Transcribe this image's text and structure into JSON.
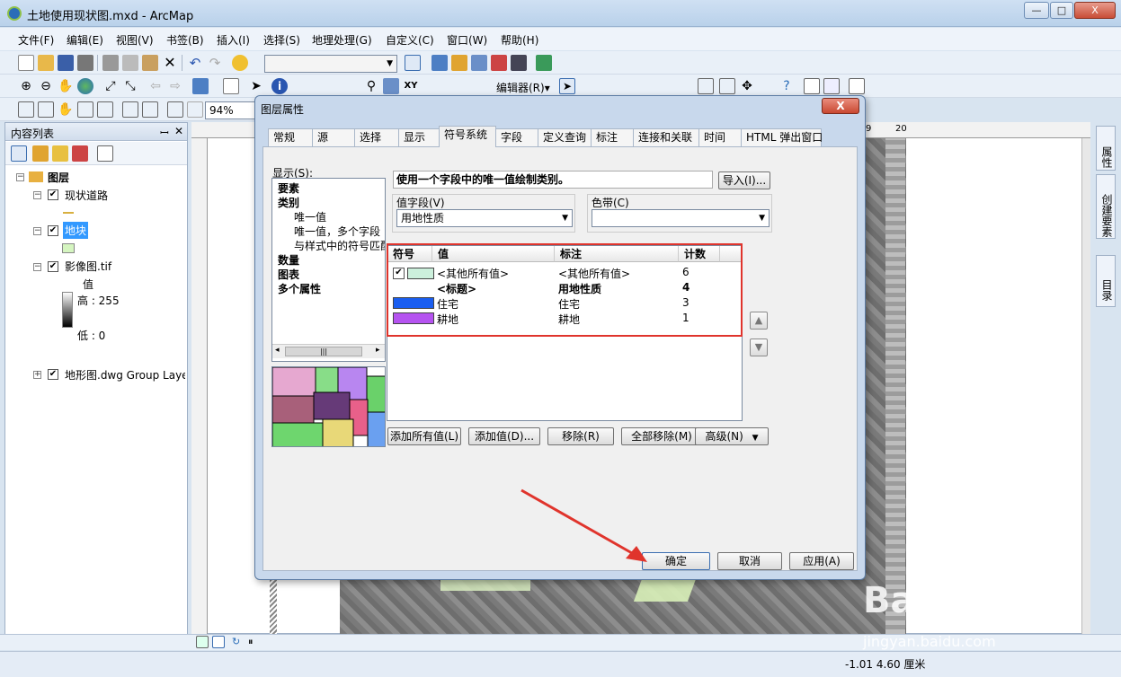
{
  "window": {
    "title": "土地使用现状图.mxd - ArcMap",
    "min": "—",
    "max": "□",
    "close": "X"
  },
  "menu": [
    "文件(F)",
    "编辑(E)",
    "视图(V)",
    "书签(B)",
    "插入(I)",
    "选择(S)",
    "地理处理(G)",
    "自定义(C)",
    "窗口(W)",
    "帮助(H)"
  ],
  "toolbar": {
    "editor_label": "编辑器(R)▾",
    "zoom_value": "94%"
  },
  "toc": {
    "title": "内容列表",
    "pin": "ꟷ",
    "close": "✕",
    "root": "图层",
    "layers": [
      {
        "name": "现状道路"
      },
      {
        "name": "地块"
      },
      {
        "name": "影像图.tif",
        "legend_title": "值",
        "high": "高 : 255",
        "low": "低 : 0"
      },
      {
        "name": "地形图.dwg Group Layer"
      }
    ]
  },
  "side_tabs": [
    "属性",
    "创建要素",
    "目录"
  ],
  "ruler": {
    "t1": "9",
    "t2": "20"
  },
  "dialog": {
    "title": "图层属性",
    "close": "X",
    "tabs": [
      "常规",
      "源",
      "选择",
      "显示",
      "符号系统",
      "字段",
      "定义查询",
      "标注",
      "连接和关联",
      "时间",
      "HTML 弹出窗口"
    ],
    "active_tab": "符号系统",
    "show_label": "显示(S):",
    "tree": [
      {
        "text": "要素",
        "bold": true
      },
      {
        "text": "类别",
        "bold": true
      },
      {
        "text": "唯一值",
        "bold": false
      },
      {
        "text": "唯一值，多个字段",
        "bold": false
      },
      {
        "text": "与样式中的符号匹配",
        "bold": false
      },
      {
        "text": "数量",
        "bold": true
      },
      {
        "text": "图表",
        "bold": true
      },
      {
        "text": "多个属性",
        "bold": true
      }
    ],
    "scroll_thumb": "|||",
    "description": "使用一个字段中的唯一值绘制类别。",
    "import_button": "导入(I)...",
    "value_field_label": "值字段(V)",
    "value_field": "用地性质",
    "color_ramp_label": "色带(C)",
    "columns": [
      "符号",
      "值",
      "标注",
      "计数"
    ],
    "rows": [
      {
        "value": "<其他所有值>",
        "label": "<其他所有值>",
        "count": "6",
        "color": "#ccf0dc",
        "checked": true,
        "bold": false
      },
      {
        "value": "<标题>",
        "label": "用地性质",
        "count": "4",
        "color": "",
        "checked": false,
        "bold": true
      },
      {
        "value": "住宅",
        "label": "住宅",
        "count": "3",
        "color": "#1a5ef0",
        "checked": false,
        "bold": false
      },
      {
        "value": "耕地",
        "label": "耕地",
        "count": "1",
        "color": "#b553f0",
        "checked": false,
        "bold": false
      }
    ],
    "buttons": {
      "add_all": "添加所有值(L)",
      "add": "添加值(D)...",
      "remove": "移除(R)",
      "remove_all": "全部移除(M)",
      "advanced": "高级(N)"
    },
    "up_arrow": "▲",
    "down_arrow": "▼",
    "ok": "确定",
    "cancel": "取消",
    "apply": "应用(A)"
  },
  "status": {
    "coords": "-1.01  4.60 厘米"
  },
  "watermark": {
    "brand": "Baidu经验",
    "url": "jingyan.baidu.com"
  },
  "colors": {
    "highlight": "#e0342c",
    "titlebar": "#b9d1ea"
  }
}
